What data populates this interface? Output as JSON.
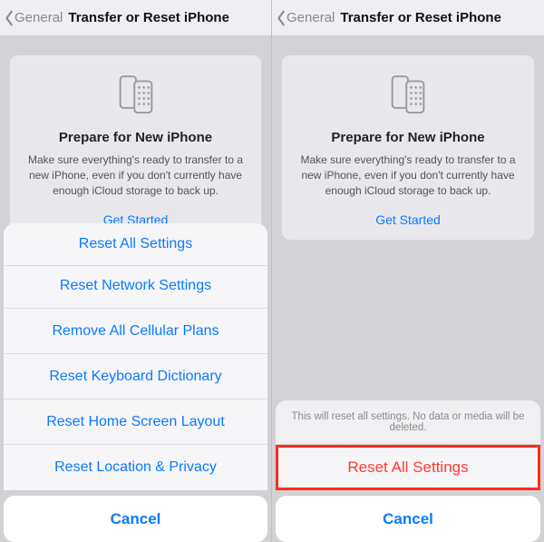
{
  "nav": {
    "back_label": "General",
    "title": "Transfer or Reset iPhone"
  },
  "card": {
    "title": "Prepare for New iPhone",
    "description": "Make sure everything's ready to transfer to a new iPhone, even if you don't currently have enough iCloud storage to back up.",
    "cta": "Get Started"
  },
  "reset_sheet": {
    "items": [
      "Reset All Settings",
      "Reset Network Settings",
      "Remove All Cellular Plans",
      "Reset Keyboard Dictionary",
      "Reset Home Screen Layout",
      "Reset Location & Privacy"
    ],
    "cancel": "Cancel"
  },
  "confirm": {
    "message": "This will reset all settings. No data or media will be deleted.",
    "action": "Reset All Settings",
    "cancel": "Cancel"
  }
}
